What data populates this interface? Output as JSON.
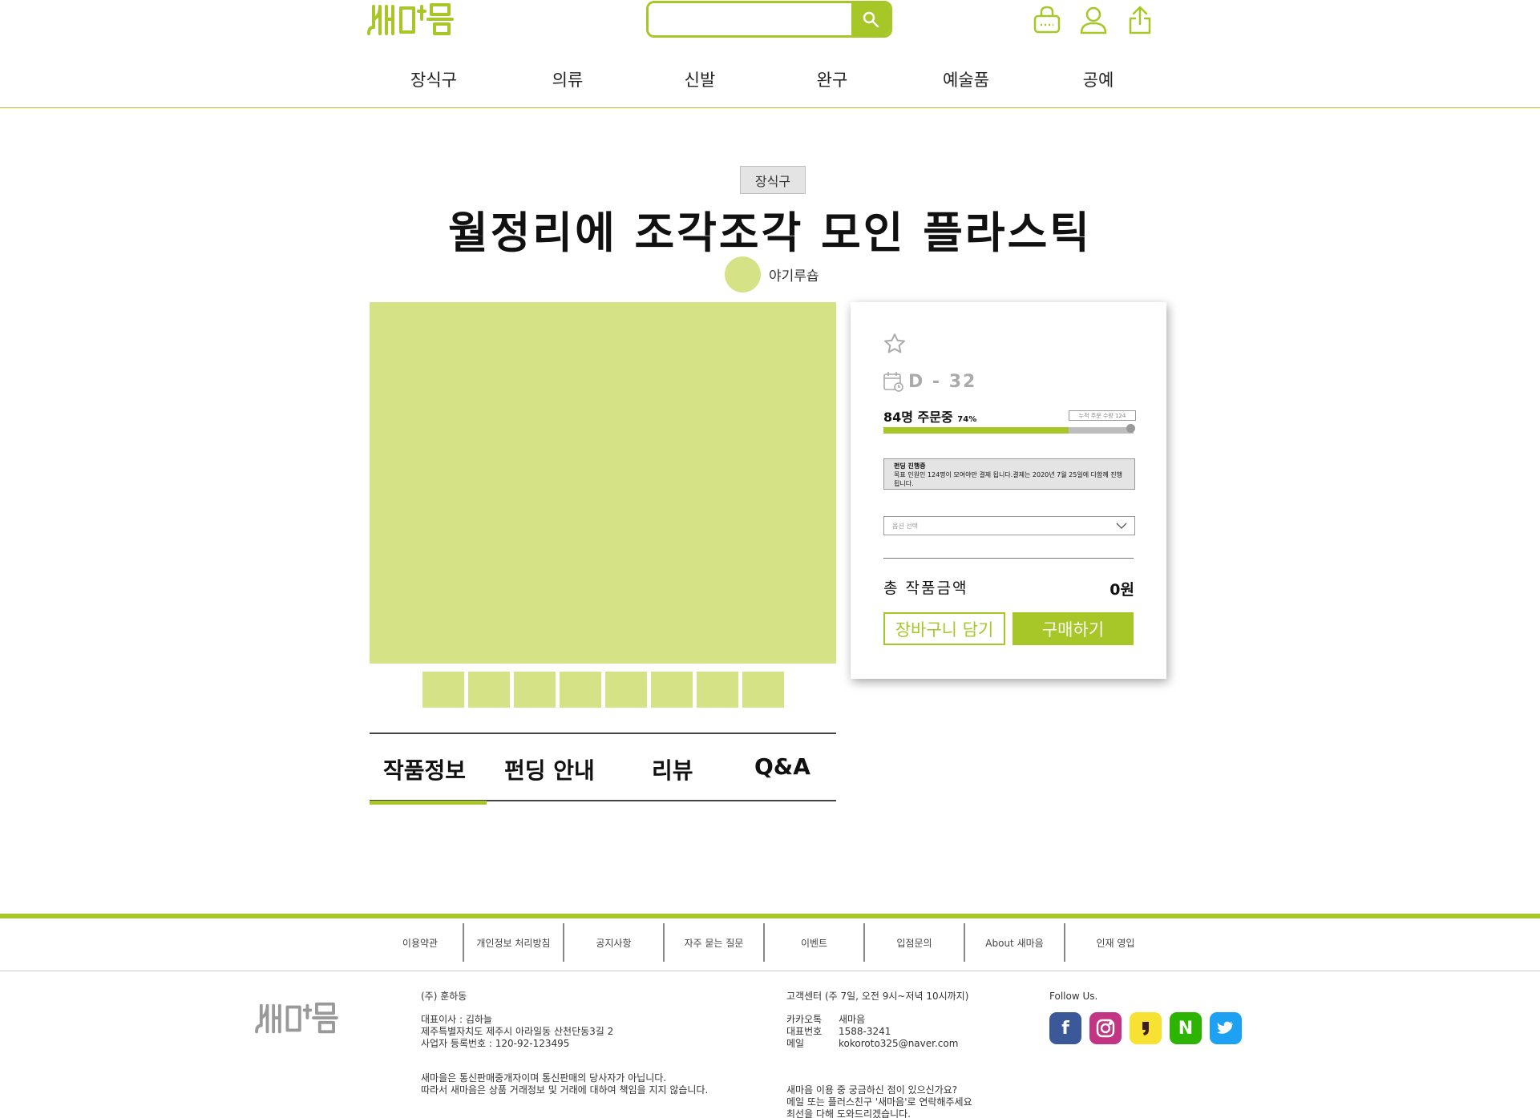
{
  "brand": {
    "accent": "#a6c727",
    "image_placeholder": "#d5e386"
  },
  "header": {
    "search": {
      "value": "",
      "placeholder": ""
    },
    "icons": [
      "cart-basket-icon",
      "user-icon",
      "share-icon"
    ]
  },
  "nav": {
    "items": [
      "장식구",
      "의류",
      "신발",
      "완구",
      "예술품",
      "공예"
    ]
  },
  "product": {
    "category": "장식구",
    "title": "월정리에 조각조각 모인 플라스틱",
    "seller": "야기루숍",
    "thumbnail_count": 8
  },
  "tabs": [
    "작품정보",
    "펀딩 안내",
    "리뷰",
    "Q&A"
  ],
  "panel": {
    "dday": "D - 32",
    "orders": "84명 주문중",
    "percent": "74%",
    "progress_fraction": 0.74,
    "cumulative": "누적 주문 수량 124",
    "notice_title": "펀딩 진행중",
    "notice_body": "목표 인원인 124명이 모여야만 결제 됩니다.결제는 2020년 7월 25일에 다함께 진행됩니다.",
    "option_placeholder": "옵션 선택",
    "total_label": "총 작품금액",
    "total_value": "0원",
    "cart_label": "장바구니 담기",
    "buy_label": "구매하기"
  },
  "footer": {
    "links": [
      "이용약관",
      "개인정보 처리방침",
      "공지사항",
      "자주 묻는 질문",
      "이벤트",
      "입점문의",
      "About 새마음",
      "인재 영입"
    ],
    "company": {
      "name": "(주) 훈하동",
      "ceo": "대표이사 : 김하늘",
      "address": "제주특별자치도 제주시 아라일동 산천단동3길 2",
      "business_no": "사업자 등록번호 : 120-92-123495",
      "disclaimer_1": "새마을은 통신판매중개자이며 통신판매의 당사자가 아닙니다.",
      "disclaimer_2": "따라서 새마음은 상품 거래정보 및 거래에 대하여 책임을 지지 않습니다."
    },
    "support": {
      "title": "고객센터 (주 7일, 오전 9시~저녁 10시까지)",
      "kakao_label": "카카오톡",
      "kakao_value": "새마음",
      "phone_label": "대표번호",
      "phone_value": "1588-3241",
      "mail_label": "메일",
      "mail_value": "kokoroto325@naver.com",
      "note_1": "새마음 이용 중 궁금하신 점이 있으신가요?",
      "note_2": "메일 또는 플러스친구 '새마음'로 연락해주세요",
      "note_3": "최선을 다해 도와드리겠습니다."
    },
    "follow_title": "Follow Us.",
    "socials": [
      {
        "name": "facebook-icon",
        "color": "#3b5998",
        "glyph": "f"
      },
      {
        "name": "instagram-icon",
        "color": "#c13584",
        "glyph": ""
      },
      {
        "name": "kakaotalk-icon",
        "color": "#f7e133",
        "glyph": ""
      },
      {
        "name": "naver-icon",
        "color": "#2db400",
        "glyph": "N"
      },
      {
        "name": "twitter-icon",
        "color": "#1da1f2",
        "glyph": ""
      }
    ]
  }
}
